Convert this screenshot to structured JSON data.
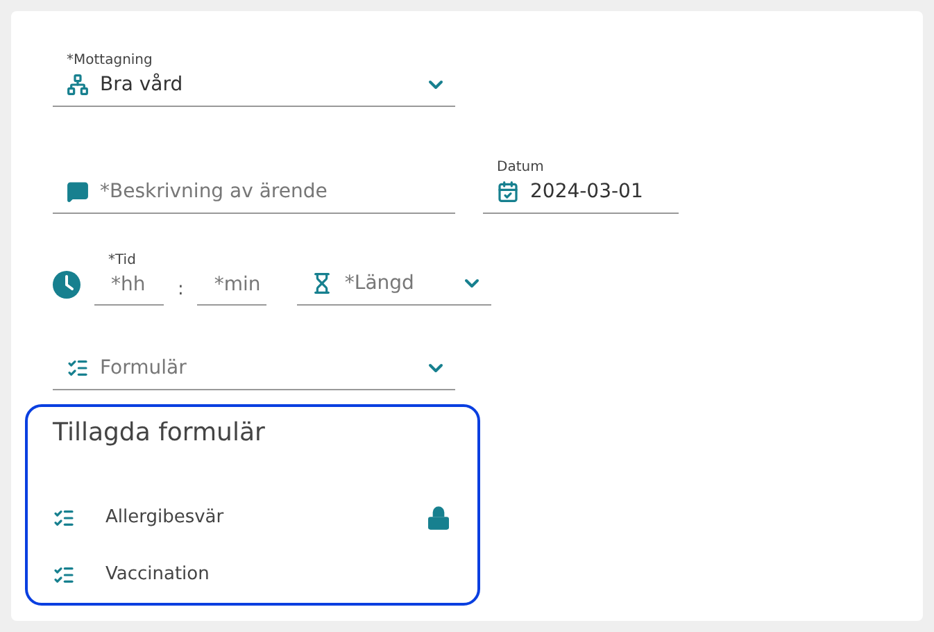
{
  "reception": {
    "label": "*Mottagning",
    "value": "Bra vård"
  },
  "description": {
    "placeholder": "*Beskrivning av ärende"
  },
  "date": {
    "label": "Datum",
    "value": "2024-03-01"
  },
  "time": {
    "label": "*Tid",
    "hours_placeholder": "*hh",
    "separator": ":",
    "minutes_placeholder": "*min"
  },
  "duration": {
    "placeholder": "*Längd"
  },
  "form_select": {
    "placeholder": "Formulär"
  },
  "added_forms": {
    "title": "Tillagda formulär",
    "items": [
      {
        "name": "Allergibesvär",
        "locked": true
      },
      {
        "name": "Vaccination",
        "locked": false
      }
    ]
  }
}
